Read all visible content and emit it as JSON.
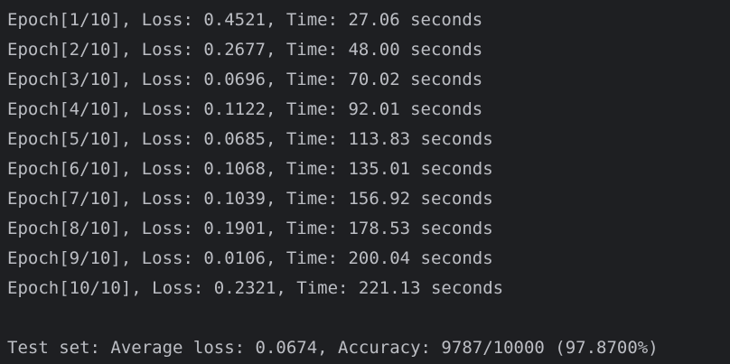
{
  "console": {
    "epoch_lines": [
      "Epoch[1/10], Loss: 0.4521, Time: 27.06 seconds",
      "Epoch[2/10], Loss: 0.2677, Time: 48.00 seconds",
      "Epoch[3/10], Loss: 0.0696, Time: 70.02 seconds",
      "Epoch[4/10], Loss: 0.1122, Time: 92.01 seconds",
      "Epoch[5/10], Loss: 0.0685, Time: 113.83 seconds",
      "Epoch[6/10], Loss: 0.1068, Time: 135.01 seconds",
      "Epoch[7/10], Loss: 0.1039, Time: 156.92 seconds",
      "Epoch[8/10], Loss: 0.1901, Time: 178.53 seconds",
      "Epoch[9/10], Loss: 0.0106, Time: 200.04 seconds",
      "Epoch[10/10], Loss: 0.2321, Time: 221.13 seconds"
    ],
    "test_line": "Test set: Average loss: 0.0674, Accuracy: 9787/10000 (97.8700%)"
  },
  "colors": {
    "background": "#1e1f22",
    "text": "#bcbec4"
  }
}
